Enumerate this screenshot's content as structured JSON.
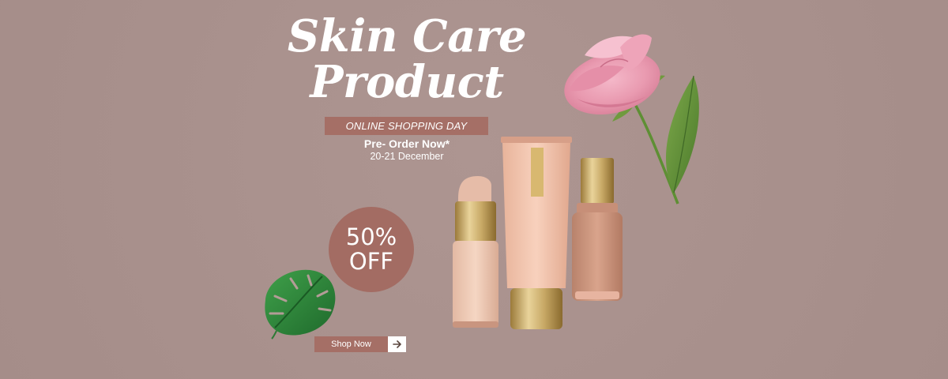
{
  "hero": {
    "title_line1": "Skin Care",
    "title_line2": "Product",
    "tag": "ONLINE SHOPPING DAY",
    "preorder": "Pre- Order Now*",
    "dates": "20-21 December"
  },
  "discount": {
    "percent": "50%",
    "off": "OFF"
  },
  "cta": {
    "label": "Shop Now",
    "icon": "arrow-right-icon"
  },
  "colors": {
    "background": "#a9918d",
    "accent": "#a56f66",
    "text": "#ffffff"
  }
}
